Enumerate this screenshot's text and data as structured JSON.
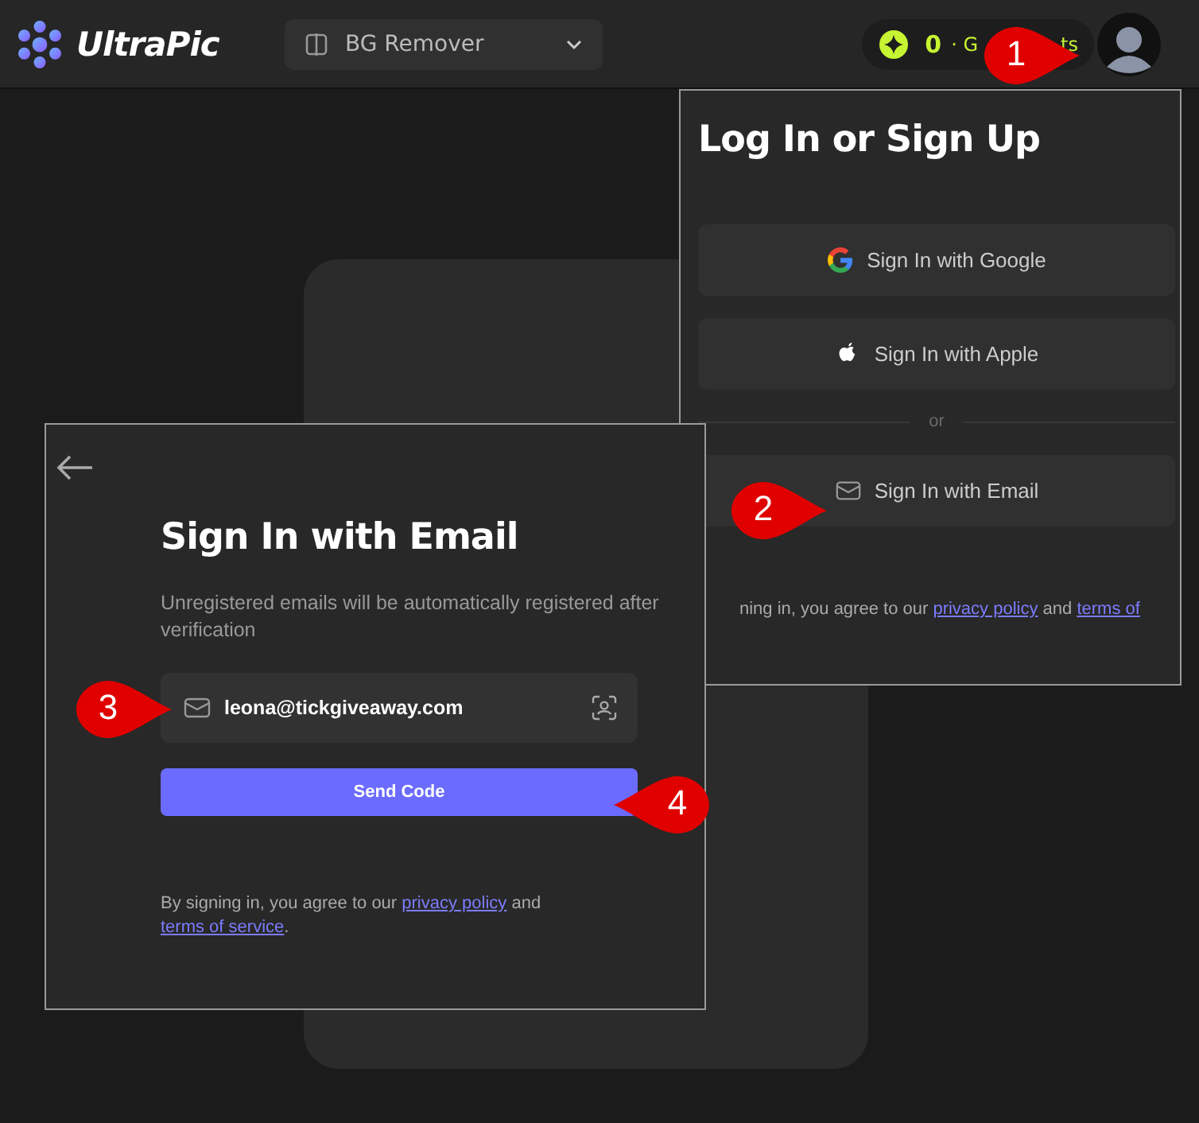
{
  "header": {
    "logo": "UltraPic",
    "tool_select": {
      "value": "BG Remover"
    },
    "credits": {
      "count": "0",
      "label_start": "· G",
      "label_end": "ts"
    }
  },
  "login_panel": {
    "title": "Log In or Sign Up",
    "buttons": [
      {
        "kind": "google",
        "label": "Sign In with Google"
      },
      {
        "kind": "apple",
        "label": "Sign In with Apple"
      }
    ],
    "divider": "or",
    "email_button": {
      "kind": "email",
      "label": "Sign In with Email"
    },
    "terms": {
      "text": "ning in, you agree to our",
      "link_1": "privacy policy",
      "joiner": "and",
      "link_2": "terms of"
    }
  },
  "email_dialog": {
    "title": "Sign In with Email",
    "subtitle": "Unregistered emails will be automatically registered after verification",
    "email_field": {
      "value": "leona@tickgiveaway.com"
    },
    "send_button": "Send Code",
    "terms": {
      "text": "By signing in, you agree to our",
      "link_1": "privacy policy",
      "joiner": "and",
      "link_2": "terms of service",
      "end": "."
    }
  },
  "callouts": [
    {
      "number": "1",
      "kind": "right"
    },
    {
      "number": "2",
      "kind": "right"
    },
    {
      "number": "3",
      "kind": "right"
    },
    {
      "number": "4",
      "kind": "left"
    }
  ]
}
